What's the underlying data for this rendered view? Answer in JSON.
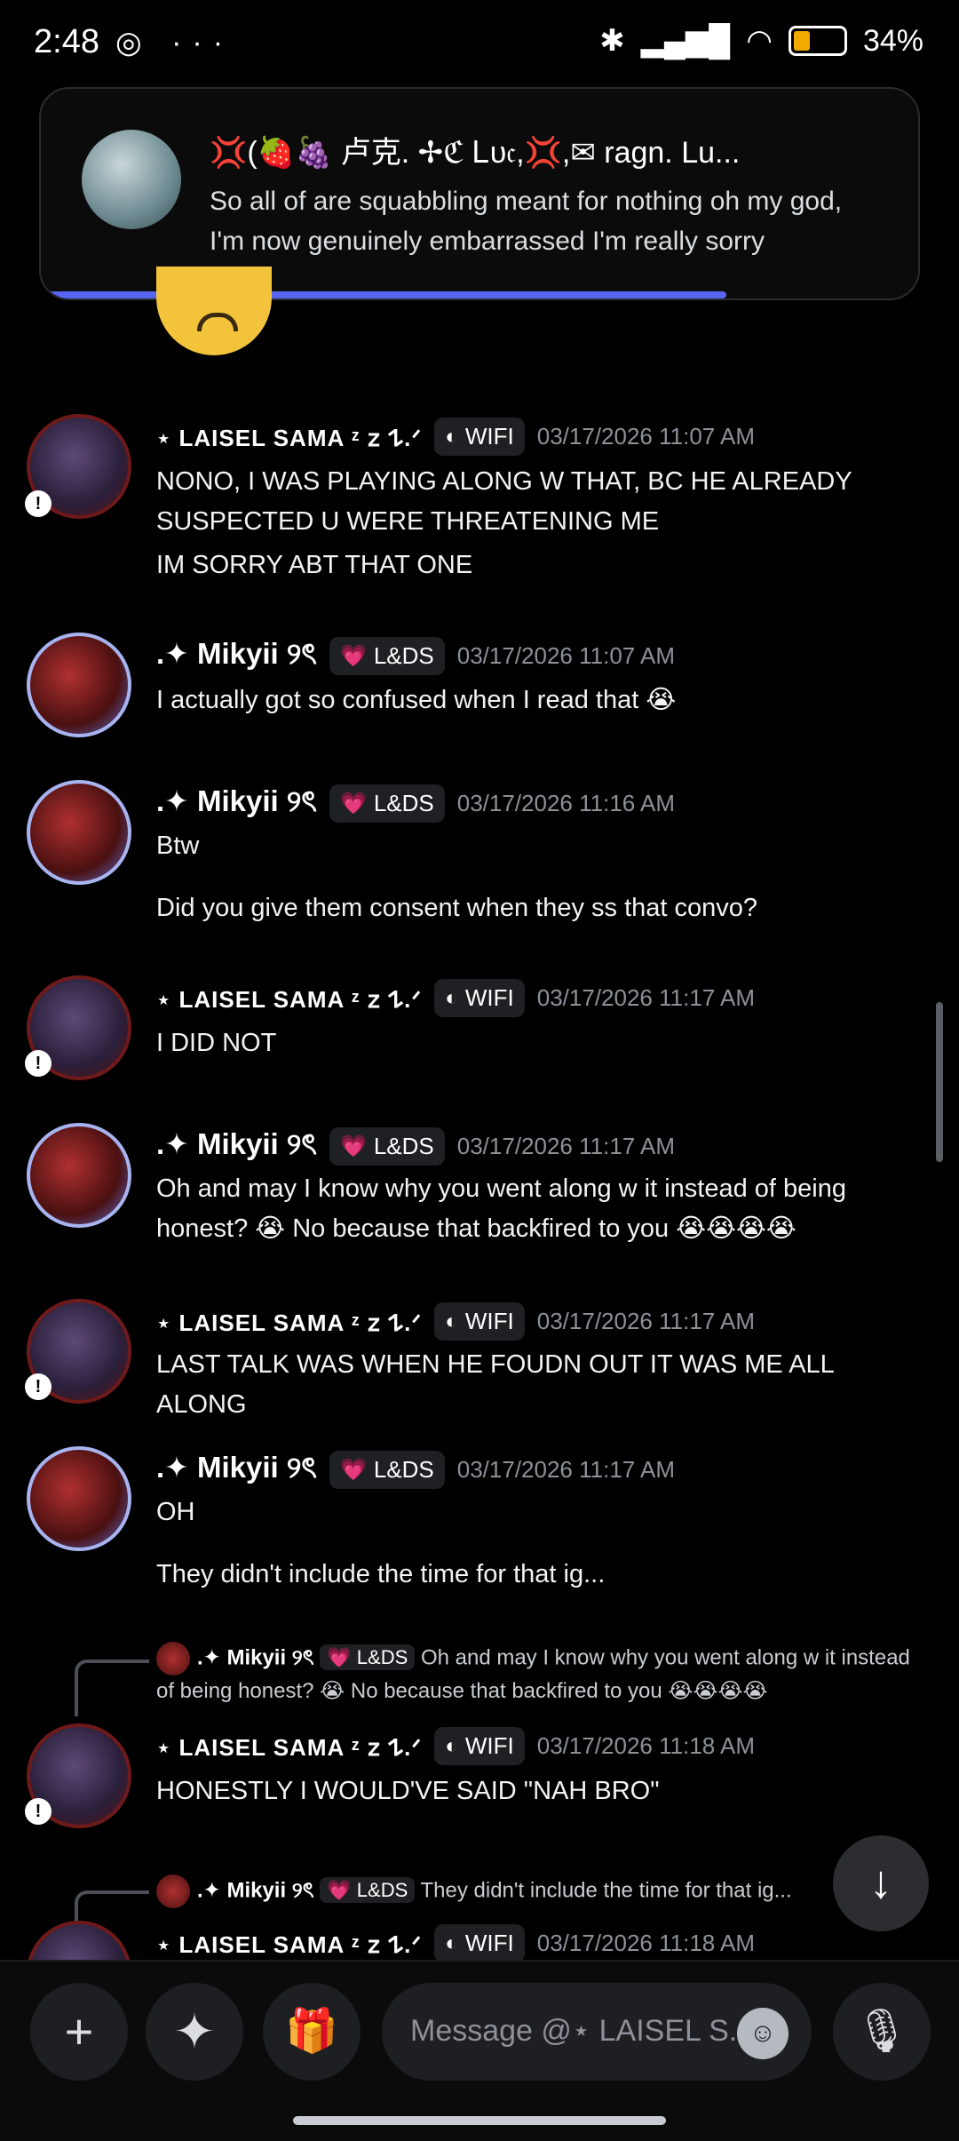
{
  "status": {
    "time": "2:48",
    "battery": "34%",
    "left_icons": "◎ ···"
  },
  "notification": {
    "title": "💢(🍓🍇  卢克. ✢ℭ Ꮮυ𝔠,💢,✉ ragn.   Lu...",
    "message": "So all of are squabbling meant for nothing oh my god, I'm now genuinely embarrassed I'm really sorry"
  },
  "tags": {
    "laisel": "WIFI",
    "mikyii": "L&DS"
  },
  "names": {
    "laisel": "⋆ LAISEL SAMA ᶻ 𝗓 𐰁.ᐟ",
    "mikyii": ".✦ Mikyii ୨ৎ"
  },
  "messages": [
    {
      "ts": "03/17/2026 11:07 AM",
      "lines": [
        "NONO, I WAS PLAYING ALONG W THAT, BC HE ALREADY SUSPECTED U WERE THREATENING ME",
        "IM SORRY ABT THAT ONE"
      ]
    },
    {
      "ts": "03/17/2026 11:07 AM",
      "lines": [
        "I actually got so confused when I read that 😭"
      ]
    },
    {
      "ts": "03/17/2026 11:16 AM",
      "lines": [
        "Btw",
        "Did you give them consent when they ss that convo?"
      ]
    },
    {
      "ts": "03/17/2026 11:17 AM",
      "lines": [
        "I DID NOT"
      ]
    },
    {
      "ts": "03/17/2026 11:17 AM",
      "lines": [
        "Oh and may I know why you went along w it instead of being honest? 😭 No because that backfired to you 😭😭😭😭"
      ]
    },
    {
      "ts": "03/17/2026 11:17 AM",
      "lines": [
        "LAST TALK WAS WHEN HE FOUDN OUT IT WAS ME ALL ALONG"
      ]
    },
    {
      "ts": "03/17/2026 11:17 AM",
      "lines": [
        "OH",
        "They didn't include the time for that ig..."
      ]
    },
    {
      "ts": "03/17/2026 11:18 AM",
      "lines": [
        "HONESTLY I WOULD'VE SAID \"NAH BRO\""
      ]
    },
    {
      "ts": "03/17/2026 11:18 AM",
      "lines": []
    }
  ],
  "replies": [
    {
      "name": ".✦ Mikyii ୨ৎ",
      "tag": "L&DS",
      "text": "Oh and may I know why you went along w it instead of being honest? 😭 No because that backfired to you 😭😭😭😭"
    },
    {
      "name": ".✦ Mikyii ୨ৎ",
      "tag": "L&DS",
      "text": "They didn't include the time for that ig..."
    }
  ],
  "composer": {
    "placeholder": "Message @⋆ LAISEL S..."
  },
  "icons": {
    "add": "+",
    "apps": "✦",
    "gift": "🎁",
    "mic": "🎙",
    "jump": "↓",
    "emoji": "☺"
  }
}
